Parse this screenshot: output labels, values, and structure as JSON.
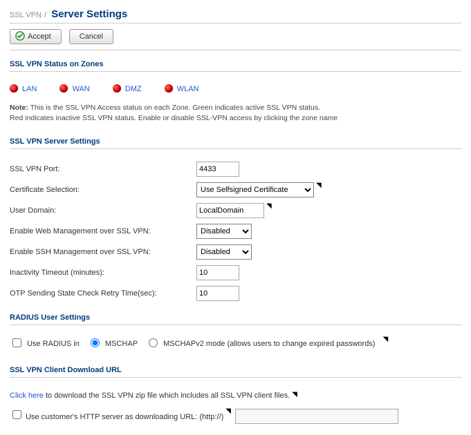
{
  "breadcrumb": {
    "parent": "SSL VPN",
    "title": "Server Settings"
  },
  "toolbar": {
    "accept": "Accept",
    "cancel": "Cancel"
  },
  "sections": {
    "zones_title": "SSL VPN Status on Zones",
    "server_title": "SSL VPN Server Settings",
    "radius_title": "RADIUS User Settings",
    "download_title": "SSL VPN Client Download URL"
  },
  "zones": {
    "lan": "LAN",
    "wan": "WAN",
    "dmz": "DMZ",
    "wlan": "WLAN"
  },
  "note": {
    "label": "Note:",
    "line1": "This is the SSL VPN Access status on each Zone. Green indicates active SSL VPN status.",
    "line2": "Red indicates inactive SSL VPN status. Enable or disable SSL-VPN access by clicking the zone name"
  },
  "form": {
    "port_label": "SSL VPN Port:",
    "port_value": "4433",
    "cert_label": "Certificate Selection:",
    "cert_value": "Use Selfsigned Certificate",
    "domain_label": "User Domain:",
    "domain_value": "LocalDomain",
    "webmgmt_label": "Enable Web Management over SSL VPN:",
    "webmgmt_value": "Disabled",
    "sshmgmt_label": "Enable SSH Management over SSL VPN:",
    "sshmgmt_value": "Disabled",
    "timeout_label": "Inactivity Timeout (minutes):",
    "timeout_value": "10",
    "otp_label": "OTP Sending State Check Retry Time(sec):",
    "otp_value": "10"
  },
  "radius": {
    "use_label": "Use RADIUS in",
    "mschap": "MSCHAP",
    "mschapv2": "MSCHAPv2 mode (allows users to change expired passwords)"
  },
  "download": {
    "click_here": "Click here",
    "desc": " to download the SSL VPN zip file which includes all SSL VPN client files.",
    "custom_label": "Use customer's HTTP server as downloading URL: (http://)"
  }
}
